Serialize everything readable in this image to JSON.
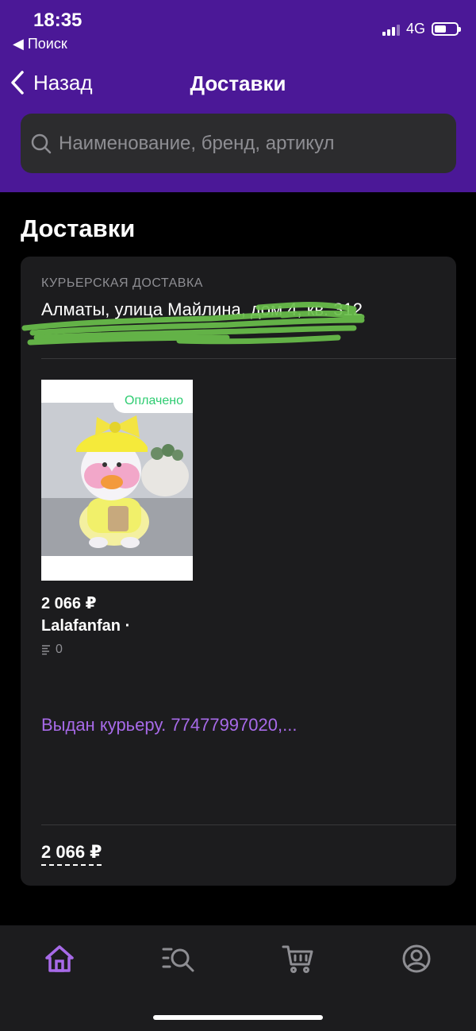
{
  "status_bar": {
    "time": "18:35",
    "back_app": "◀ Поиск",
    "network": "4G"
  },
  "nav": {
    "back_label": "Назад",
    "title": "Доставки"
  },
  "search": {
    "placeholder": "Наименование, бренд, артикул"
  },
  "page": {
    "title": "Доставки"
  },
  "delivery": {
    "type": "КУРЬЕРСКАЯ ДОСТАВКА",
    "address": "Алматы, улица Майлина, дом 4, кв. 312",
    "product": {
      "status_badge": "Оплачено",
      "price": "2 066 ₽",
      "brand": "Lalafanfan ·",
      "review_count": "0"
    },
    "status_text": "Выдан курьеру. 77477997020,...",
    "total": "2 066 ₽"
  },
  "tabs": [
    {
      "name": "home",
      "icon": "home-icon",
      "active": true
    },
    {
      "name": "catalog",
      "icon": "catalog-search-icon",
      "active": false
    },
    {
      "name": "cart",
      "icon": "cart-icon",
      "active": false
    },
    {
      "name": "profile",
      "icon": "profile-icon",
      "active": false
    }
  ],
  "colors": {
    "header_bg": "#4b1897",
    "accent": "#a76ae8",
    "paid_green": "#2ecc71",
    "card_bg": "#1c1c1e"
  }
}
